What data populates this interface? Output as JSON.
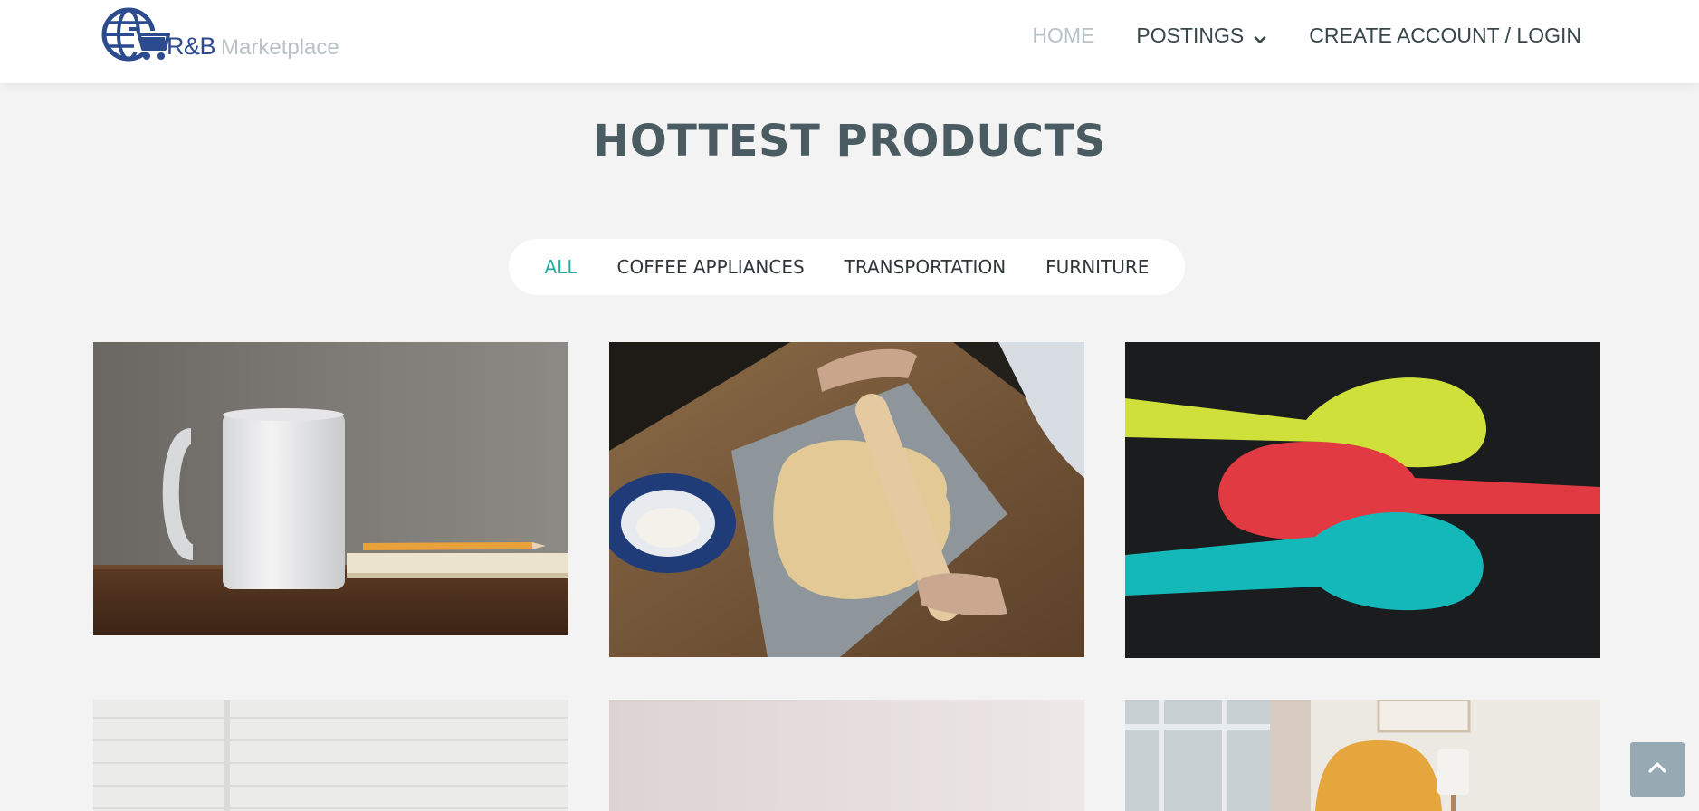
{
  "header": {
    "logo_text_primary": "R&B",
    "logo_text_secondary": "Marketplace",
    "logo_icon": "globe-cart-icon",
    "nav": [
      {
        "label": "HOME",
        "active": true
      },
      {
        "label": "POSTINGS",
        "dropdown": true,
        "icon": "chevron-down-icon"
      },
      {
        "label": "CREATE ACCOUNT / LOGIN"
      }
    ]
  },
  "main": {
    "title": "HOTTEST PRODUCTS",
    "filters": [
      {
        "label": "ALL",
        "active": true
      },
      {
        "label": "COFFEE APPLIANCES"
      },
      {
        "label": "TRANSPORTATION"
      },
      {
        "label": "FURNITURE"
      }
    ],
    "products": [
      {
        "image": "white-mug-photo"
      },
      {
        "image": "rolling-pin-dough-photo"
      },
      {
        "image": "colorful-spoons-photo"
      },
      {
        "image": "white-brick-wall-photo"
      },
      {
        "image": "pink-wall-photo"
      },
      {
        "image": "armchair-lamp-photo"
      }
    ]
  },
  "back_to_top": {
    "icon": "chevron-up-icon"
  },
  "colors": {
    "accent": "#1fae9c",
    "brand_blue": "#2c4a8e",
    "page_bg": "#f2f3f2",
    "title": "#4a5b61"
  }
}
